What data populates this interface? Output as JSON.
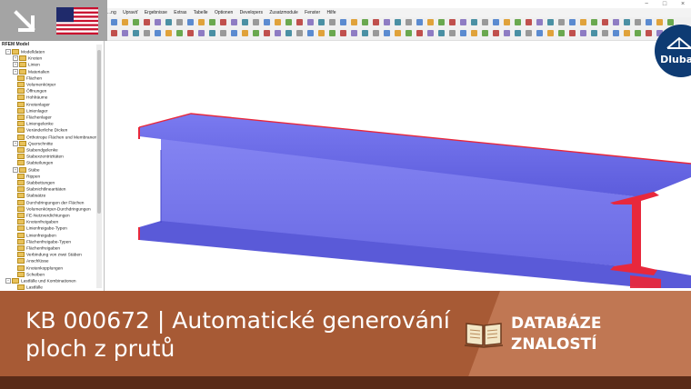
{
  "window": {
    "min_glyph": "−",
    "max_glyph": "□",
    "close_glyph": "×"
  },
  "menu": [
    "...ng",
    "Upraviť",
    "Ergebnisse",
    "Extras",
    "Tabelle",
    "Optionen",
    "Developers",
    "Zusatzmodule",
    "Fenster",
    "Hilfe"
  ],
  "navigator": {
    "title": "RFEM Model",
    "items": [
      {
        "label": "Modelldaten",
        "depth": 1,
        "expander": "−"
      },
      {
        "label": "Knoten",
        "depth": 2,
        "expander": "+"
      },
      {
        "label": "Linien",
        "depth": 2,
        "expander": "+"
      },
      {
        "label": "Materialien",
        "depth": 2,
        "expander": "+"
      },
      {
        "label": "Flächen",
        "depth": 2,
        "expander": ""
      },
      {
        "label": "Volumenkörper",
        "depth": 2,
        "expander": ""
      },
      {
        "label": "Öffnungen",
        "depth": 2,
        "expander": ""
      },
      {
        "label": "Hohlräume",
        "depth": 2,
        "expander": ""
      },
      {
        "label": "Knotenlager",
        "depth": 2,
        "expander": ""
      },
      {
        "label": "Linienlager",
        "depth": 2,
        "expander": ""
      },
      {
        "label": "Flächenlager",
        "depth": 2,
        "expander": ""
      },
      {
        "label": "Liniengelenke",
        "depth": 2,
        "expander": ""
      },
      {
        "label": "Veränderliche Dicken",
        "depth": 2,
        "expander": ""
      },
      {
        "label": "Orthotrope Flächen und Membranen",
        "depth": 2,
        "expander": ""
      },
      {
        "label": "Querschnitte",
        "depth": 2,
        "expander": "+"
      },
      {
        "label": "Stabendgelenke",
        "depth": 2,
        "expander": ""
      },
      {
        "label": "Stabexzentrizitäten",
        "depth": 2,
        "expander": ""
      },
      {
        "label": "Stabteilungen",
        "depth": 2,
        "expander": ""
      },
      {
        "label": "Stäbe",
        "depth": 2,
        "expander": "+"
      },
      {
        "label": "Rippen",
        "depth": 2,
        "expander": ""
      },
      {
        "label": "Stabbettungen",
        "depth": 2,
        "expander": ""
      },
      {
        "label": "Stabnichtlinearitäten",
        "depth": 2,
        "expander": ""
      },
      {
        "label": "Stabsätze",
        "depth": 2,
        "expander": ""
      },
      {
        "label": "Durchdringungen der Flächen",
        "depth": 2,
        "expander": ""
      },
      {
        "label": "Volumenkörper-Durchdringungen",
        "depth": 2,
        "expander": ""
      },
      {
        "label": "FE-Netzverdichtungen",
        "depth": 2,
        "expander": ""
      },
      {
        "label": "Knotenfreigaben",
        "depth": 2,
        "expander": ""
      },
      {
        "label": "Linienfreigabe-Typen",
        "depth": 2,
        "expander": ""
      },
      {
        "label": "Linienfreigaben",
        "depth": 2,
        "expander": ""
      },
      {
        "label": "Flächenfreigabe-Typen",
        "depth": 2,
        "expander": ""
      },
      {
        "label": "Flächenfreigaben",
        "depth": 2,
        "expander": ""
      },
      {
        "label": "Verbindung von zwei Stäben",
        "depth": 2,
        "expander": ""
      },
      {
        "label": "Anschlüsse",
        "depth": 2,
        "expander": ""
      },
      {
        "label": "Knotenkopplungen",
        "depth": 2,
        "expander": ""
      },
      {
        "label": "Scheiben",
        "depth": 2,
        "expander": ""
      },
      {
        "label": "Lastfälle und Kombinationen",
        "depth": 1,
        "expander": "−"
      },
      {
        "label": "Lastfälle",
        "depth": 2,
        "expander": ""
      }
    ]
  },
  "logo": {
    "text": "Dlubal"
  },
  "banner": {
    "title_line1": "KB 000672 | Automatické generování",
    "title_line2": "ploch z prutů",
    "kb_line1": "DATABÁZE",
    "kb_line2": "ZNALOSTÍ"
  },
  "icons": {
    "corner": "arrow-down-right-icon",
    "flag": "us-flag-icon",
    "logo": "dlubal-bridge-icon",
    "book": "open-book-icon"
  },
  "colors": {
    "beam_face": "#6e6ee8",
    "beam_edge": "#e8283c",
    "banner_left": "#a75a35",
    "banner_right": "#c07753",
    "logo_bg": "#0e3b73",
    "flag_corner_bg": "#a4a4a4"
  }
}
